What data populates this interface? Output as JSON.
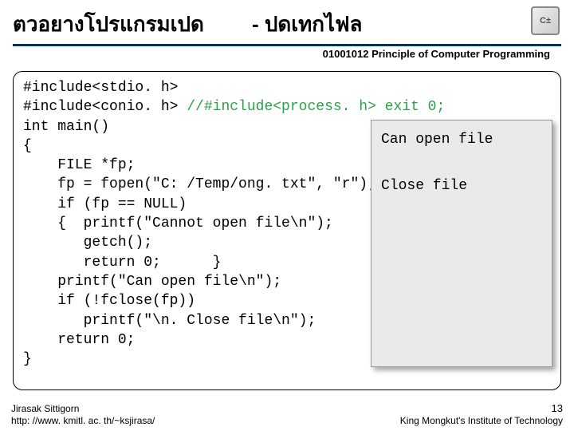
{
  "header": {
    "title_left": "ตวอยางโปรแกรมเปด",
    "title_right": "- ปดเทกไฟล",
    "course": "01001012 Principle of Computer Programming",
    "logo_text": "C±"
  },
  "code": {
    "l1": "#include<stdio. h>",
    "l2a": "#include<conio. h> ",
    "l2b": "//#include<process. h> exit 0;",
    "l3": "int main()",
    "l4": "{",
    "l5": "    FILE *fp;",
    "l6": "    fp = fopen(\"C: /Temp/ong. txt\", \"r\");",
    "l7": "    if (fp == NULL)",
    "l8": "    {  printf(\"Cannot open file\\n\");",
    "l9": "       getch();",
    "l10": "       return 0;      }",
    "l11": "    printf(\"Can open file\\n\");",
    "l12": "    if (!fclose(fp))",
    "l13": "       printf(\"\\n. Close file\\n\");",
    "l14": "    return 0;",
    "l15": "}"
  },
  "output": {
    "line1": "Can open file",
    "line2": "Close file"
  },
  "footer": {
    "author": "Jirasak Sittigorn",
    "url": "http: //www. kmitl. ac. th/~ksjirasa/",
    "page": "13",
    "institute": "King Mongkut's Institute of Technology"
  }
}
